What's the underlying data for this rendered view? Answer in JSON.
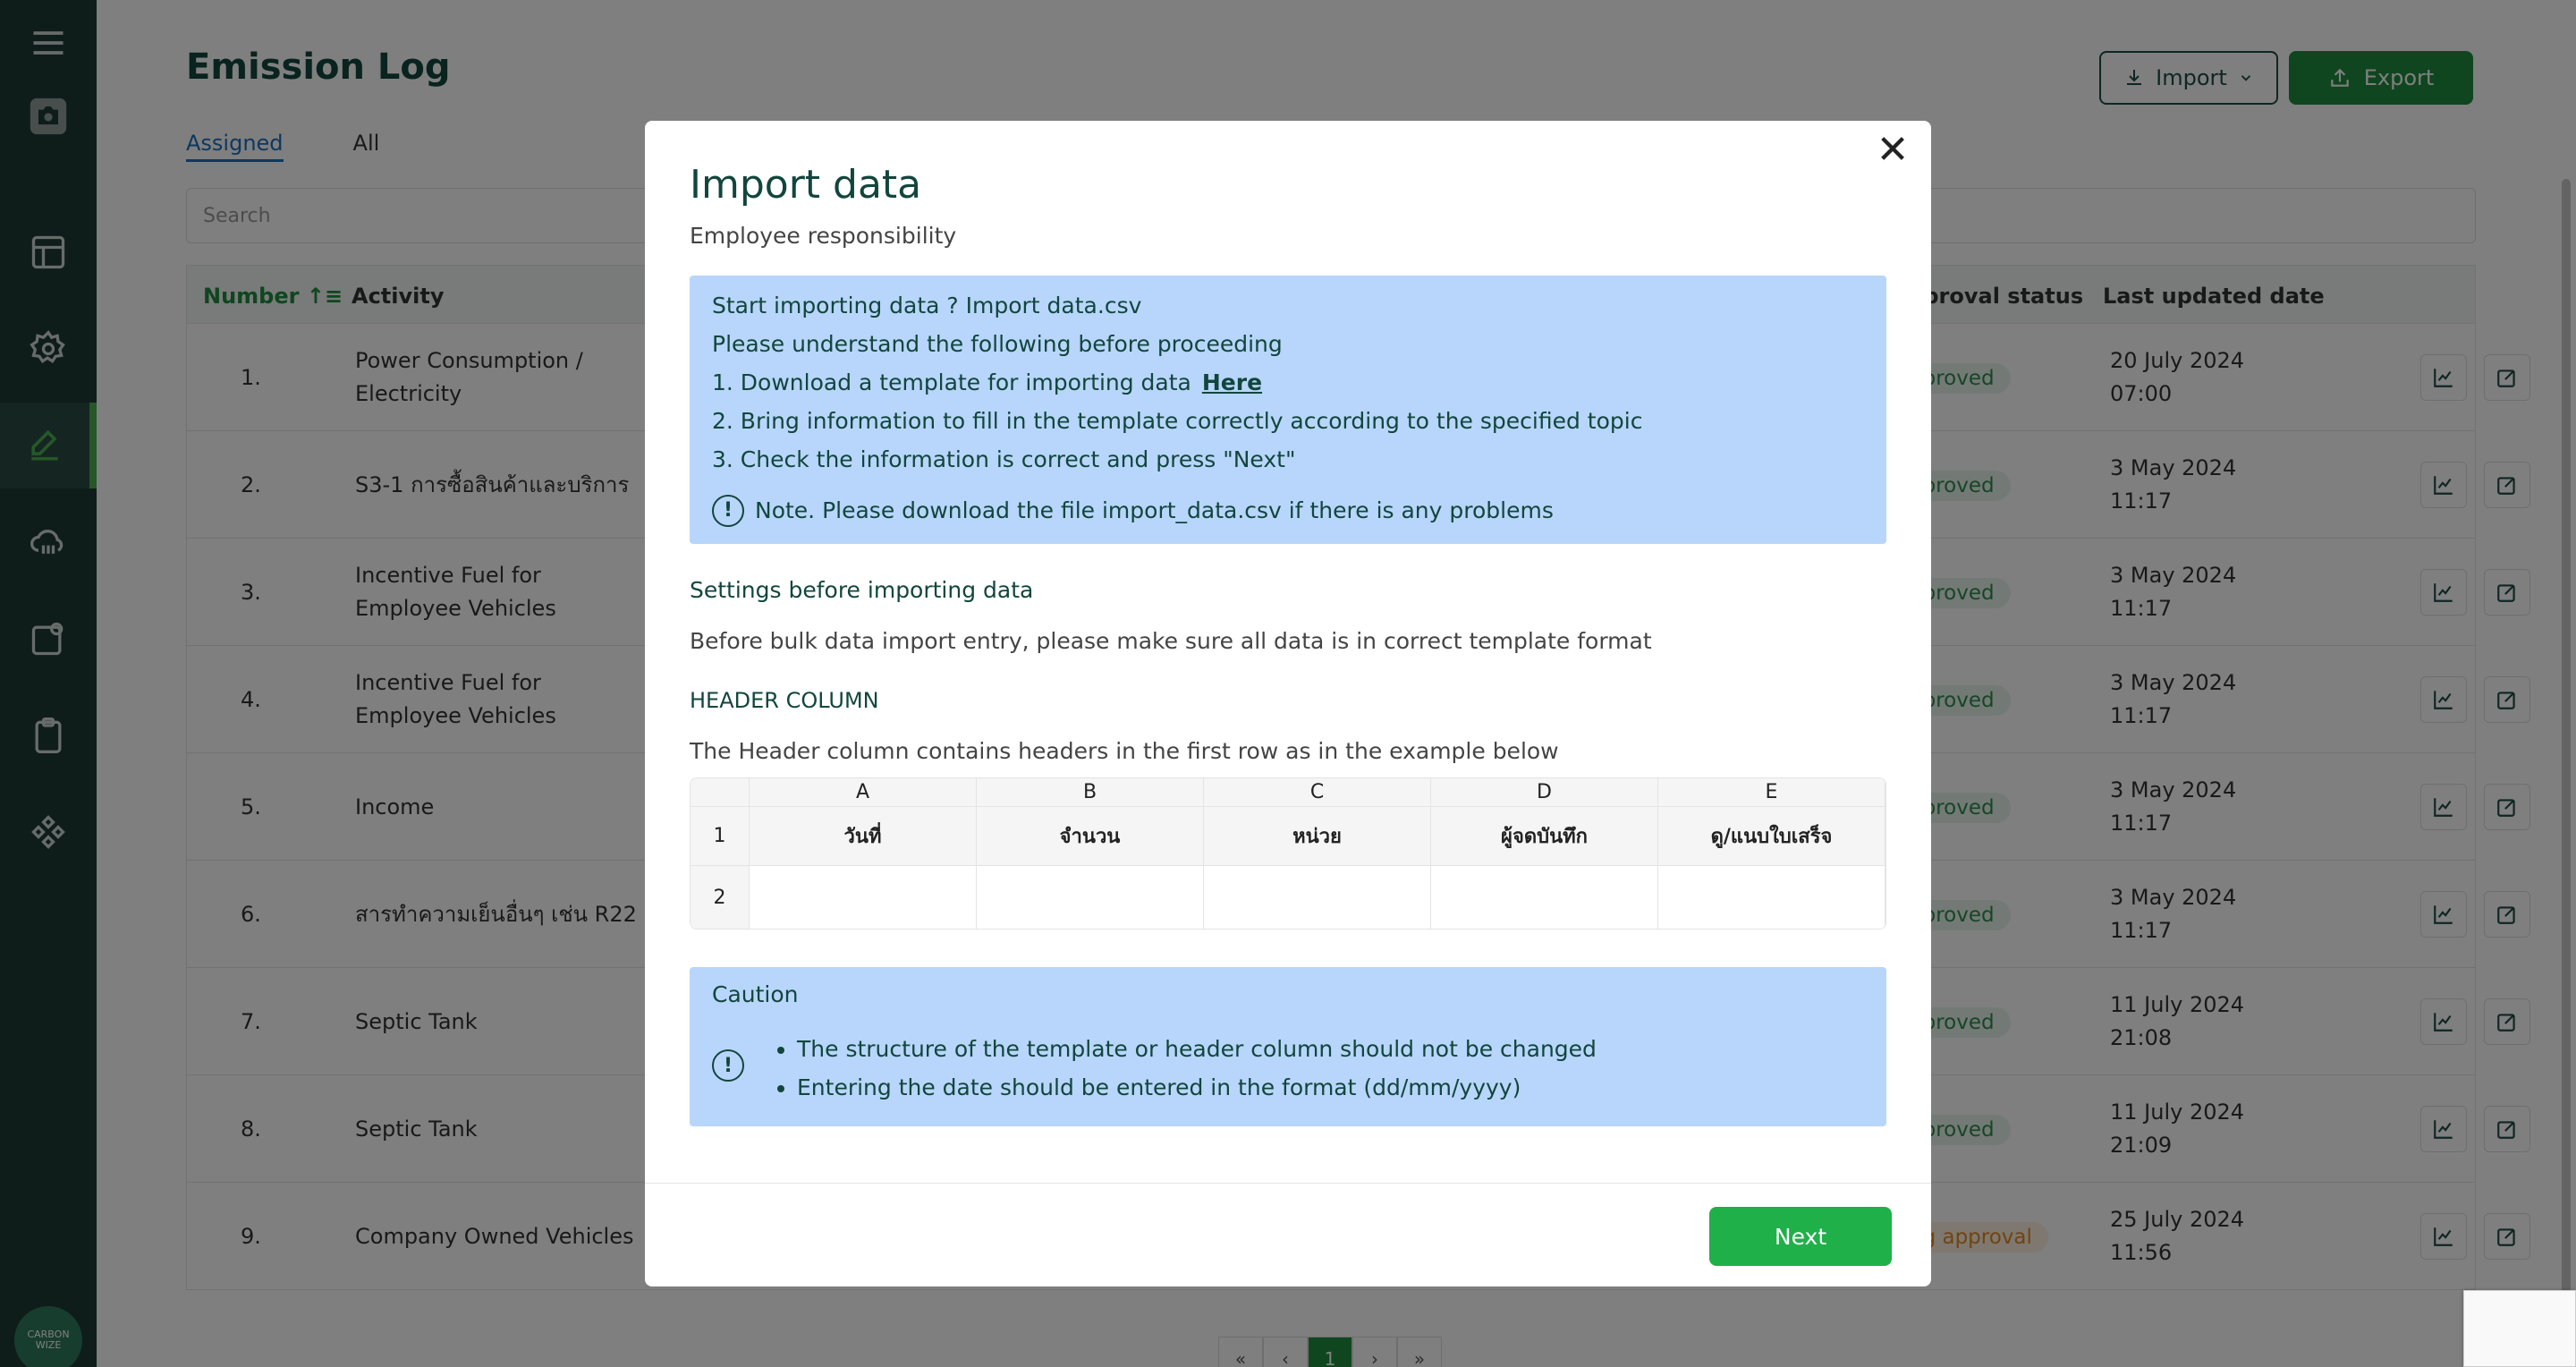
{
  "app": {
    "page_title": "Emission Log",
    "logo_text": "CARBON WIZE"
  },
  "sidebar": {
    "items": [
      {
        "icon": "menu-icon"
      },
      {
        "icon": "camera-icon"
      },
      {
        "icon": "layout-icon"
      },
      {
        "icon": "gear-icon"
      },
      {
        "icon": "edit-icon",
        "active": true
      },
      {
        "icon": "cloud-icon"
      },
      {
        "icon": "clipboard-person-icon"
      },
      {
        "icon": "clipboard-icon"
      },
      {
        "icon": "grid-icon"
      }
    ]
  },
  "header": {
    "import_label": "Import",
    "export_label": "Export"
  },
  "tabs": [
    "Assigned",
    "All"
  ],
  "search": {
    "placeholder": "Search"
  },
  "table": {
    "columns": {
      "number": "Number",
      "activity": "Activity",
      "status": "approval status",
      "updated": "Last updated date"
    },
    "rows": [
      {
        "num": "1.",
        "activity": "Power Consumption / Electricity",
        "status": "pproved",
        "date": "20 July 2024 07:00"
      },
      {
        "num": "2.",
        "activity": "S3-1 การซื้อสินค้าและบริการ",
        "status": "pproved",
        "date": "3 May 2024 11:17"
      },
      {
        "num": "3.",
        "activity": "Incentive Fuel for Employee Vehicles",
        "status": "pproved",
        "date": "3 May 2024 11:17"
      },
      {
        "num": "4.",
        "activity": "Incentive Fuel for Employee Vehicles",
        "status": "pproved",
        "date": "3 May 2024 11:17"
      },
      {
        "num": "5.",
        "activity": "Income",
        "status": "pproved",
        "date": "3 May 2024 11:17"
      },
      {
        "num": "6.",
        "activity": "สารทำความเย็นอื่นๆ เช่น R22",
        "status": "pproved",
        "date": "3 May 2024 11:17"
      },
      {
        "num": "7.",
        "activity": "Septic Tank",
        "status": "pproved",
        "date": "11 July 2024 21:08"
      },
      {
        "num": "8.",
        "activity": "Septic Tank",
        "status": "pproved",
        "date": "11 July 2024 21:09"
      },
      {
        "num": "9.",
        "activity": "Company Owned Vehicles",
        "status": "ng approval",
        "date": "25 July 2024 11:56"
      }
    ]
  },
  "pagination": {
    "first": "«",
    "prev": "‹",
    "current": "1",
    "next": "›",
    "last": "»"
  },
  "modal": {
    "close": "✕",
    "title": "Import data",
    "subtitle": "Employee responsibility",
    "info": {
      "line1": "Start importing data ? Import data.csv",
      "line2": "Please understand the following before proceeding",
      "line3": "1. Download a template for importing data",
      "here": "Here",
      "line4": "2. Bring information to fill in the template correctly according to the specified topic",
      "line5": "3. Check the information is correct and press \"Next\"",
      "note": "Note. Please download the file import_data.csv if there is any problems"
    },
    "settings_title": "Settings before importing data",
    "settings_desc": "Before bulk data import entry, please make sure all data is in correct template format",
    "header_col_title": "HEADER COLUMN",
    "header_col_desc": "The Header column contains headers in the first row as in the example below",
    "sheet": {
      "letters": [
        "A",
        "B",
        "C",
        "D",
        "E"
      ],
      "row_numbers": [
        "1",
        "2"
      ],
      "headers": [
        "วันที่",
        "จำนวน",
        "หน่วย",
        "ผู้จดบันทึก",
        "ดู/แนบใบเสร็จ"
      ]
    },
    "caution": {
      "title": "Caution",
      "items": [
        "The structure of the template or header column should not be changed",
        "Entering the date should be entered in the format (dd/mm/yyyy)"
      ]
    },
    "next_label": "Next"
  },
  "colors": {
    "sidebar": "#1e3a34",
    "brand_green": "#1f8c3f",
    "next_green": "#1fb04a",
    "info_blue": "#b8d6fb",
    "title_teal": "#12463d"
  }
}
